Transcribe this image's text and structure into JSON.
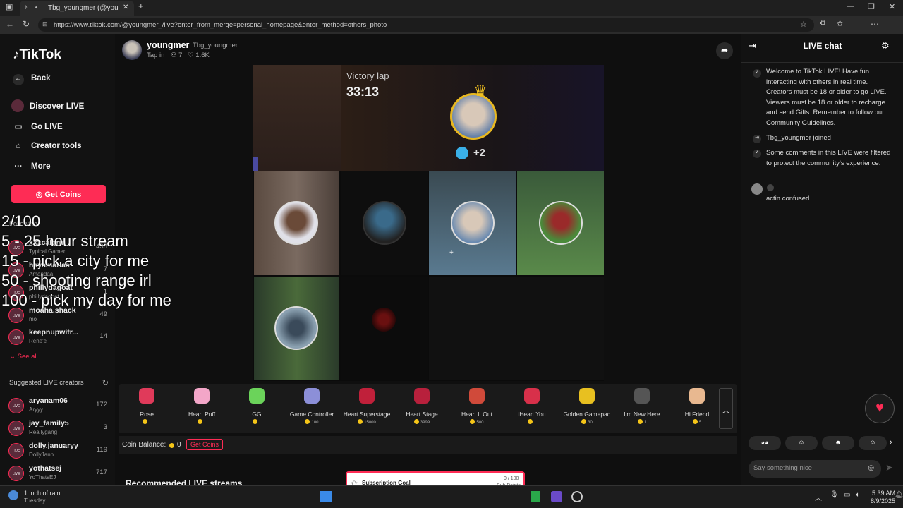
{
  "browser": {
    "tab_title": "Tbg_youngmer (@youngmer_",
    "url": "https://www.tiktok.com/@youngmer_/live?enter_from_merge=personal_homepage&enter_method=others_photo",
    "new_tab": "+"
  },
  "sidebar": {
    "logo": "TikTok",
    "back": "Back",
    "nav": [
      {
        "label": "Discover LIVE",
        "icon": "discover-live-icon"
      },
      {
        "label": "Go LIVE",
        "icon": "camera-icon"
      },
      {
        "label": "Creator tools",
        "icon": "home-icon"
      },
      {
        "label": "More",
        "icon": "more-icon"
      }
    ],
    "get_coins": "Get Coins",
    "following_title": "Following",
    "following": [
      {
        "name": "xxxcalgrm",
        "sub": "Typical Gamer",
        "count": "438"
      },
      {
        "name": "hayamarlaa",
        "sub": "Amandaa",
        "count": "7"
      },
      {
        "name": "phillydagoat",
        "sub": "phillydagoat",
        "count": "1"
      },
      {
        "name": "moaha.shack",
        "sub": "mo",
        "count": "49"
      },
      {
        "name": "keepnupwitr...",
        "sub": "Rene'e",
        "count": "14"
      }
    ],
    "see_all": "See all",
    "suggested_title": "Suggested LIVE creators",
    "suggested": [
      {
        "name": "aryanam06",
        "sub": "Aryyy",
        "count": "172"
      },
      {
        "name": "jay_family5",
        "sub": "Reallygang",
        "count": "3"
      },
      {
        "name": "dolly.januaryy",
        "sub": "DollyJann",
        "count": "119"
      },
      {
        "name": "yothatsej",
        "sub": "YoThatsEJ",
        "count": "717"
      }
    ],
    "live_badge": "LIVE"
  },
  "overlay_lines": [
    "2/100",
    "5 - 25 hour stream",
    "15 - pick a city for me",
    "50 - shooting range irl",
    "100 - pick my day for me"
  ],
  "host": {
    "name": "youngmer_",
    "handle": "Tbg_youngmer",
    "tap_in": "Tap in",
    "viewers": "7",
    "likes": "1.6K"
  },
  "video": {
    "label": "Victory lap",
    "timer": "33:13",
    "plus": "+2"
  },
  "gifts": [
    {
      "name": "Rose",
      "price": "1",
      "color": "#e03a5a"
    },
    {
      "name": "Heart Puff",
      "price": "1",
      "color": "#f3a6c8"
    },
    {
      "name": "GG",
      "price": "1",
      "color": "#6bd35a"
    },
    {
      "name": "Game Controller",
      "price": "100",
      "color": "#8c8fd8"
    },
    {
      "name": "Heart Superstage",
      "price": "15000",
      "color": "#c0203a"
    },
    {
      "name": "Heart Stage",
      "price": "3999",
      "color": "#b8203c"
    },
    {
      "name": "Heart It Out",
      "price": "500",
      "color": "#d04a3a"
    },
    {
      "name": "iHeart You",
      "price": "1",
      "color": "#d8304a"
    },
    {
      "name": "Golden Gamepad",
      "price": "30",
      "color": "#e8c020"
    },
    {
      "name": "I'm New Here",
      "price": "1",
      "color": "#555555"
    },
    {
      "name": "Hi Friend",
      "price": "5",
      "color": "#e8b890"
    }
  ],
  "balance": {
    "label": "Coin Balance:",
    "value": "0",
    "get_coins": "Get Coins"
  },
  "recommended": "Recommended LIVE streams",
  "chat": {
    "title": "LIVE chat",
    "messages": [
      {
        "text": "Welcome to TikTok LIVE! Have fun interacting with others in real time. Creators must be 18 or older to go LIVE. Viewers must be 18 or older to recharge and send Gifts. Remember to follow our Community Guidelines."
      },
      {
        "text": "Tbg_youngmer joined"
      },
      {
        "text": "Some comments in this LIVE were filtered to protect the community's experience."
      },
      {
        "text": "actin confused"
      }
    ],
    "input_placeholder": "Say something nice"
  },
  "subscription": {
    "title": "Subscription Goal",
    "progress": "0 / 100",
    "points": "Sub Points"
  },
  "taskbar": {
    "weather": "1 inch of rain",
    "day": "Tuesday",
    "time": "5:39 AM",
    "date": "8/9/2025"
  }
}
